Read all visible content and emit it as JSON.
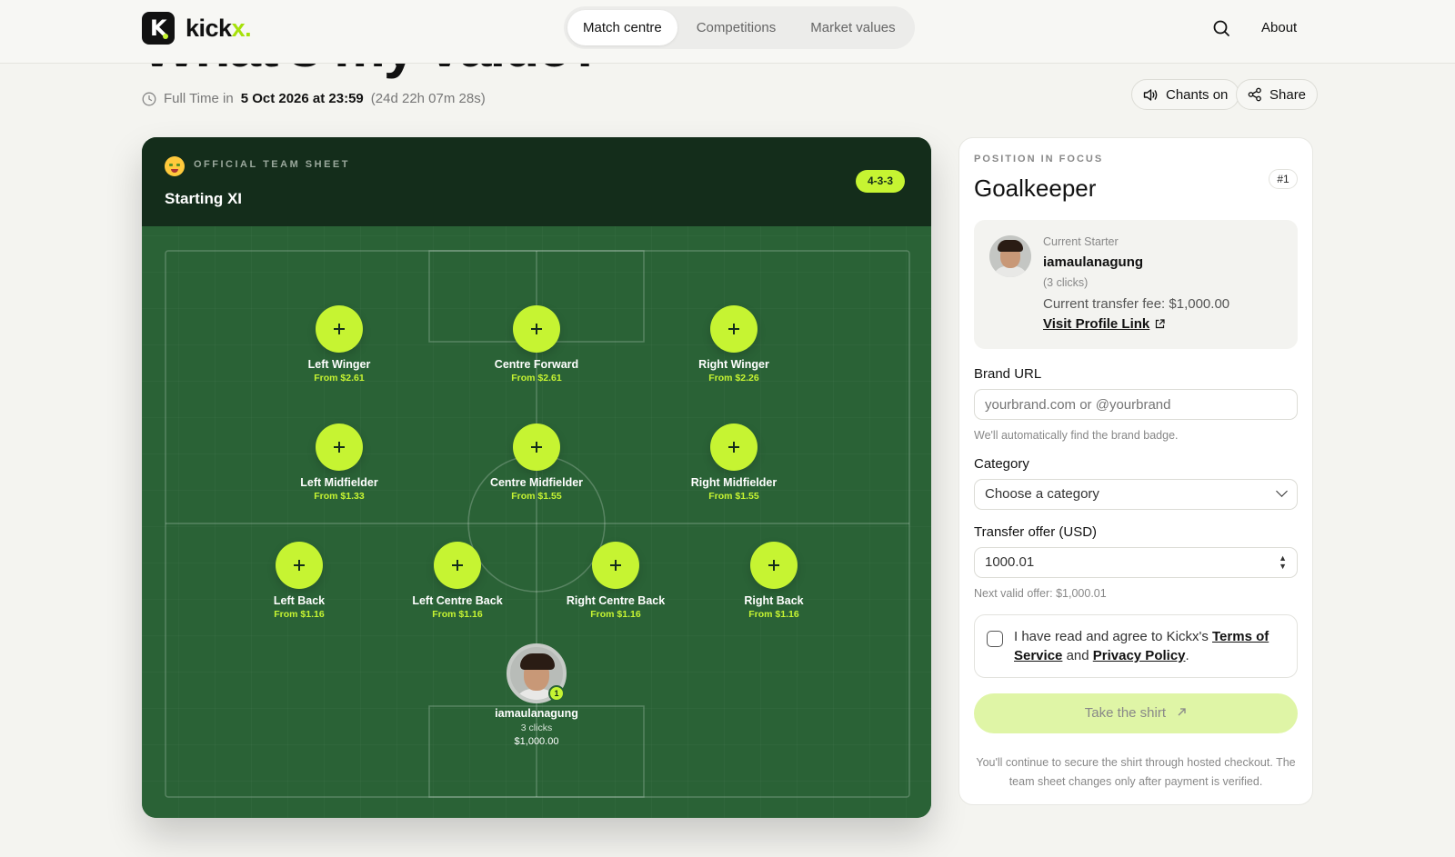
{
  "brand": {
    "mark": "K",
    "name_main": "kick",
    "name_accent": "x",
    "name_dot": "."
  },
  "nav": {
    "tabs": [
      "Match centre",
      "Competitions",
      "Market values"
    ],
    "active": 0,
    "about": "About"
  },
  "page": {
    "title": "What's my value?",
    "time_prefix": "Full Time in",
    "date": "5 Oct 2026 at 23:59",
    "countdown": "(24d 22h 07m 28s)",
    "chants_label": "Chants on",
    "share_label": "Share"
  },
  "team_sheet": {
    "kicker": "OFFICIAL TEAM SHEET",
    "title": "Starting XI",
    "formation": "4-3-3",
    "positions": [
      {
        "name": "Left Winger",
        "price": "From $2.61"
      },
      {
        "name": "Centre Forward",
        "price": "From $2.61"
      },
      {
        "name": "Right Winger",
        "price": "From $2.26"
      },
      {
        "name": "Left Midfielder",
        "price": "From $1.33"
      },
      {
        "name": "Centre Midfielder",
        "price": "From $1.55"
      },
      {
        "name": "Right Midfielder",
        "price": "From $1.55"
      },
      {
        "name": "Left Back",
        "price": "From $1.16"
      },
      {
        "name": "Left Centre Back",
        "price": "From $1.16"
      },
      {
        "name": "Right Centre Back",
        "price": "From $1.16"
      },
      {
        "name": "Right Back",
        "price": "From $1.16"
      }
    ],
    "goalkeeper": {
      "number": "1",
      "name": "iamaulanagung",
      "clicks": "3 clicks",
      "fee": "$1,000.00"
    }
  },
  "panel": {
    "kicker": "POSITION IN FOCUS",
    "title": "Goalkeeper",
    "number": "#1",
    "starter": {
      "label": "Current Starter",
      "name": "iamaulanagung",
      "clicks": "(3 clicks)",
      "fee": "Current transfer fee: $1,000.00",
      "link": "Visit Profile Link"
    },
    "brand_url": {
      "label": "Brand URL",
      "placeholder": "yourbrand.com or @yourbrand",
      "help": "We'll automatically find the brand badge."
    },
    "category": {
      "label": "Category",
      "value": "Choose a category"
    },
    "offer": {
      "label": "Transfer offer (USD)",
      "value": "1000.01",
      "help": "Next valid offer: $1,000.01"
    },
    "agree": {
      "prefix": "I have read and agree to Kickx's",
      "terms": "Terms of Service",
      "and": "and",
      "privacy": "Privacy Policy",
      "suffix": "."
    },
    "cta": "Take the shirt",
    "footnote": "You'll continue to secure the shirt through hosted checkout. The team sheet changes only after payment is verified."
  },
  "colors": {
    "accent": "#c6f432",
    "pitch": "#2a6236",
    "pitch_header": "#142d1b",
    "cta_disabled": "#dff5a6"
  }
}
